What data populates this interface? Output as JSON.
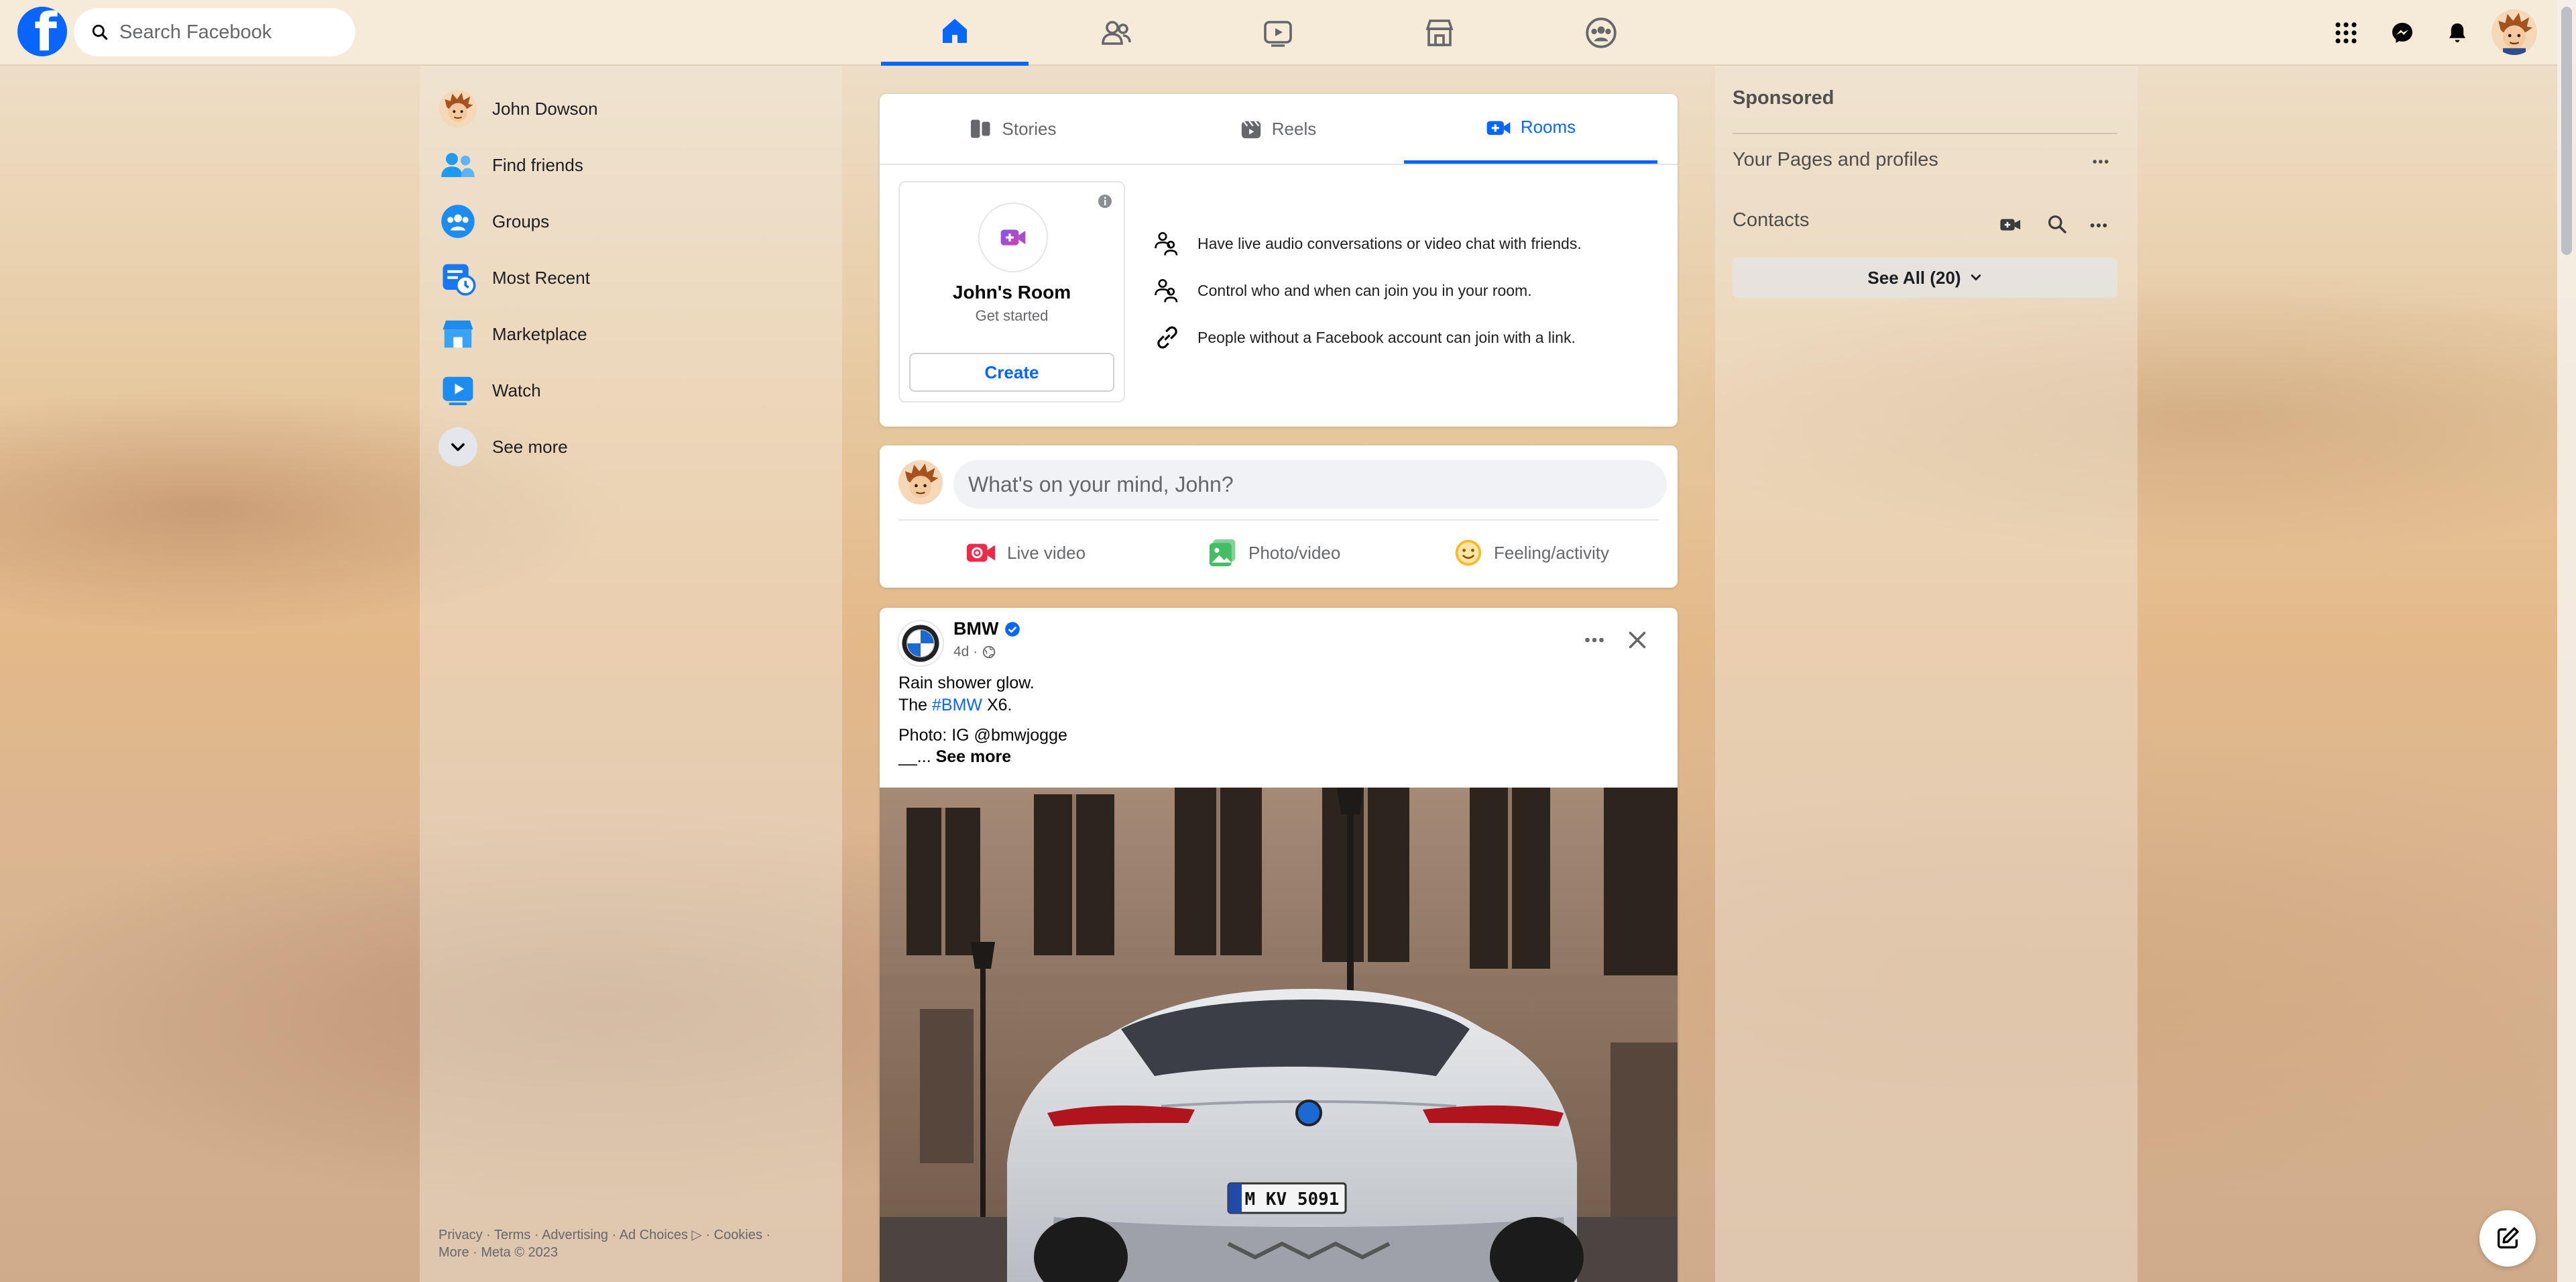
{
  "header": {
    "logo_letter": "f",
    "search_placeholder": "Search Facebook",
    "nav_tabs": [
      {
        "name": "home",
        "icon": "home-icon",
        "active": true
      },
      {
        "name": "friends",
        "icon": "friends-icon"
      },
      {
        "name": "watch",
        "icon": "video-icon"
      },
      {
        "name": "marketplace",
        "icon": "store-icon"
      },
      {
        "name": "groups",
        "icon": "groups-icon"
      }
    ],
    "right_icons": [
      "menu-grid-icon",
      "messenger-icon",
      "notifications-icon",
      "account-avatar"
    ]
  },
  "sidebar": {
    "items": [
      {
        "label": "John Dowson",
        "icon": "avatar"
      },
      {
        "label": "Find friends",
        "icon": "friends-icon"
      },
      {
        "label": "Groups",
        "icon": "groups-icon"
      },
      {
        "label": "Most Recent",
        "icon": "most-recent-icon"
      },
      {
        "label": "Marketplace",
        "icon": "marketplace-icon"
      },
      {
        "label": "Watch",
        "icon": "watch-icon"
      },
      {
        "label": "See more",
        "icon": "chevron-down-icon"
      }
    ],
    "footer": {
      "line1": "Privacy · Terms · Advertising · Ad Choices ▷ · Cookies ·",
      "line2": "More · Meta © 2023"
    }
  },
  "stories_card": {
    "tabs": [
      {
        "label": "Stories",
        "icon": "stories-icon"
      },
      {
        "label": "Reels",
        "icon": "reels-icon"
      },
      {
        "label": "Rooms",
        "icon": "rooms-icon",
        "active": true
      }
    ],
    "room": {
      "title": "John's Room",
      "subtitle": "Get started",
      "create_label": "Create"
    },
    "features": [
      "Have live audio conversations or video chat with friends.",
      "Control who and when can join you in your room.",
      "People without a Facebook account can join with a link."
    ]
  },
  "composer": {
    "placeholder": "What's on your mind, John?",
    "actions": [
      {
        "label": "Live video",
        "color": "#f02849"
      },
      {
        "label": "Photo/video",
        "color": "#45bd62"
      },
      {
        "label": "Feeling/activity",
        "color": "#f7b928"
      }
    ]
  },
  "post": {
    "author": "BMW",
    "verified": true,
    "time": "4d ·",
    "line1": "Rain shower glow.",
    "line2_prefix": "The ",
    "hashtag": "#BMW",
    "line2_suffix": " X6.",
    "line3": "Photo: IG @bmwjogge",
    "line4_prefix": "__... ",
    "see_more": "See more",
    "plate": "M KV 5091"
  },
  "right": {
    "sponsored": "Sponsored",
    "pages_title": "Your Pages and profiles",
    "contacts_title": "Contacts",
    "see_all": "See All (20)"
  },
  "colors": {
    "accent": "#0866ff",
    "text_secondary": "#65676b"
  }
}
